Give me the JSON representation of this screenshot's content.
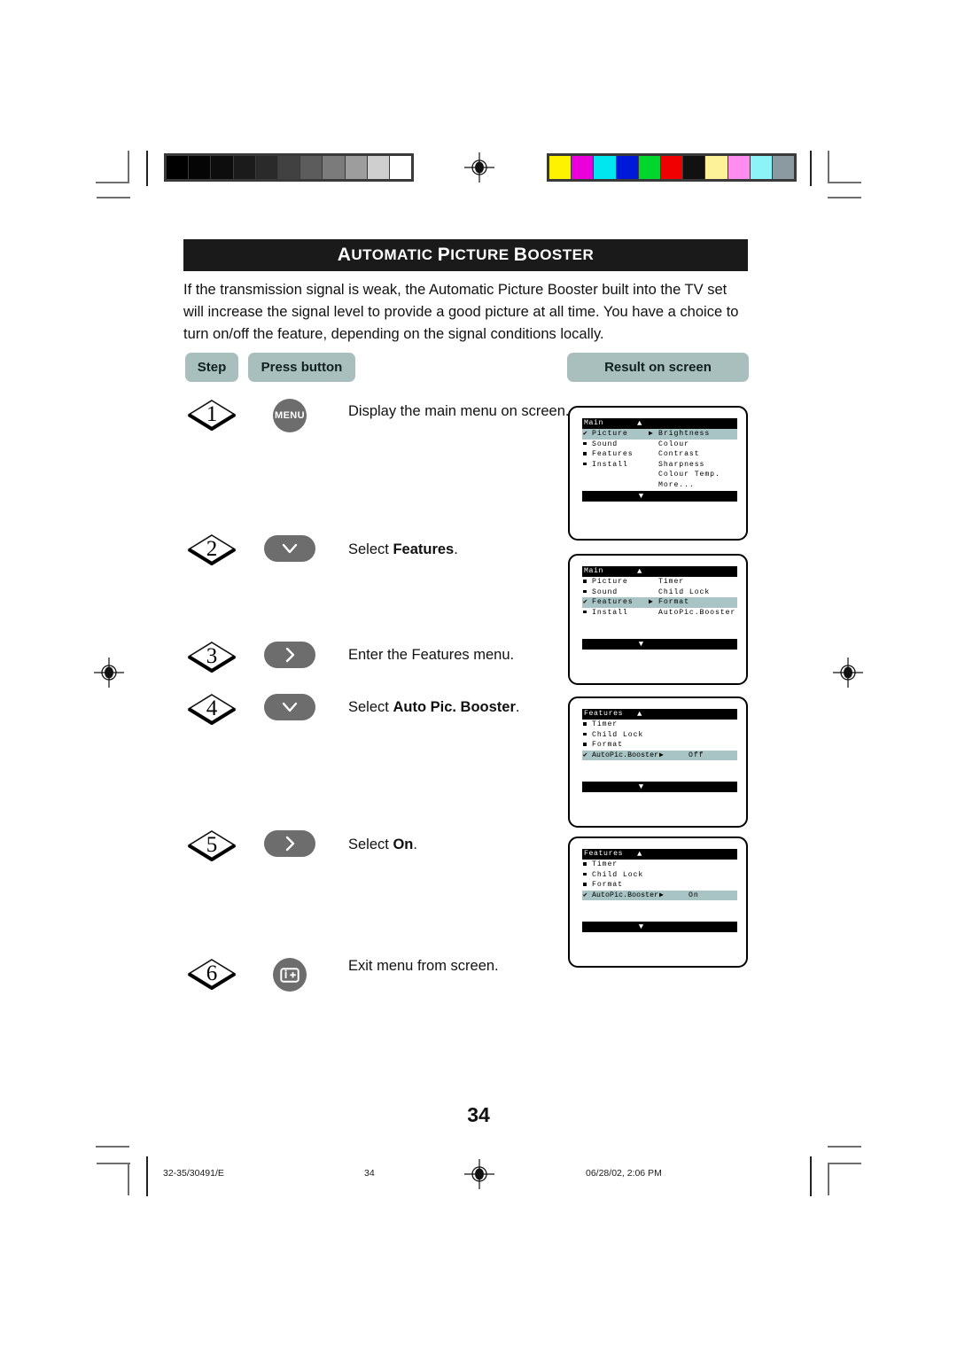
{
  "document": {
    "title_words": [
      "Automatic",
      "Picture",
      "Booster"
    ],
    "title_full": "AUTOMATIC PICTURE BOOSTER",
    "intro": "If the transmission signal is weak, the Automatic Picture Booster built into the TV set will increase the signal level to provide a good picture at all time. You have a choice to turn on/off the feature, depending on the signal conditions locally.",
    "page_number": "34"
  },
  "table_headers": {
    "step": "Step",
    "press_button": "Press button",
    "result": "Result on screen"
  },
  "steps": [
    {
      "number": "1",
      "button_kind": "round",
      "button_label": "MENU",
      "icon_name": "menu-button",
      "text_prefix": "Display the main menu on screen.",
      "text_bold": "",
      "text_suffix": ""
    },
    {
      "number": "2",
      "button_kind": "oval",
      "button_label": "",
      "icon_name": "chevron-down-icon",
      "text_prefix": "Select ",
      "text_bold": "Features",
      "text_suffix": "."
    },
    {
      "number": "3",
      "button_kind": "oval",
      "button_label": "",
      "icon_name": "chevron-right-icon",
      "text_prefix": "Enter the Features menu.",
      "text_bold": "",
      "text_suffix": ""
    },
    {
      "number": "4",
      "button_kind": "oval",
      "button_label": "",
      "icon_name": "chevron-down-icon",
      "text_prefix": "Select ",
      "text_bold": "Auto Pic. Booster",
      "text_suffix": "."
    },
    {
      "number": "5",
      "button_kind": "oval",
      "button_label": "",
      "icon_name": "chevron-right-icon",
      "text_prefix": "Select ",
      "text_bold": "On",
      "text_suffix": "."
    },
    {
      "number": "6",
      "button_kind": "round",
      "button_label": "",
      "icon_name": "exit-info-button",
      "text_prefix": "Exit menu from screen.",
      "text_bold": "",
      "text_suffix": ""
    }
  ],
  "osd_screens": [
    {
      "name": "main-picture",
      "title": "Main",
      "rows": [
        {
          "mark": "check",
          "left": "Picture",
          "arrow": true,
          "right": "Brightness",
          "highlight": true
        },
        {
          "mark": "square",
          "left": "Sound",
          "arrow": false,
          "right": "Colour",
          "highlight": false
        },
        {
          "mark": "square",
          "left": "Features",
          "arrow": false,
          "right": "Contrast",
          "highlight": false
        },
        {
          "mark": "square",
          "left": "Install",
          "arrow": false,
          "right": "Sharpness",
          "highlight": false
        },
        {
          "mark": "none",
          "left": "",
          "arrow": false,
          "right": "Colour Temp.",
          "highlight": false
        },
        {
          "mark": "none",
          "left": "",
          "arrow": false,
          "right": "More...",
          "highlight": false
        }
      ],
      "blank_rows": 0
    },
    {
      "name": "main-features",
      "title": "Main",
      "rows": [
        {
          "mark": "square",
          "left": "Picture",
          "arrow": false,
          "right": "Timer",
          "highlight": false
        },
        {
          "mark": "square",
          "left": "Sound",
          "arrow": false,
          "right": "Child Lock",
          "highlight": false
        },
        {
          "mark": "check",
          "left": "Features",
          "arrow": true,
          "right": "Format",
          "highlight": true
        },
        {
          "mark": "square",
          "left": "Install",
          "arrow": false,
          "right": "AutoPic.Booster",
          "highlight": false
        }
      ],
      "blank_rows": 2
    },
    {
      "name": "features-autopic-off",
      "title": "Features",
      "rows": [
        {
          "mark": "square",
          "left": "Timer",
          "arrow": false,
          "right": "",
          "highlight": false
        },
        {
          "mark": "square",
          "left": "Child Lock",
          "arrow": false,
          "right": "",
          "highlight": false
        },
        {
          "mark": "square",
          "left": "Format",
          "arrow": false,
          "right": "",
          "highlight": false
        },
        {
          "mark": "check",
          "left": "AutoPic.Booster",
          "arrow": true,
          "right": "Off",
          "highlight": true
        }
      ],
      "blank_rows": 2
    },
    {
      "name": "features-autopic-on",
      "title": "Features",
      "rows": [
        {
          "mark": "square",
          "left": "Timer",
          "arrow": false,
          "right": "",
          "highlight": false
        },
        {
          "mark": "square",
          "left": "Child Lock",
          "arrow": false,
          "right": "",
          "highlight": false
        },
        {
          "mark": "square",
          "left": "Format",
          "arrow": false,
          "right": "",
          "highlight": false
        },
        {
          "mark": "check",
          "left": "AutoPic.Booster",
          "arrow": true,
          "right": "On",
          "highlight": true
        }
      ],
      "blank_rows": 2
    }
  ],
  "footer": {
    "left": "32-35/30491/E",
    "center": "34",
    "right": "06/28/02, 2:06 PM"
  },
  "colors": {
    "pill_bg": "#a8bfbd",
    "osd_highlight": "#a8c4c4",
    "title_bg": "#1a1a1a",
    "button_bg": "#6d6d6d"
  },
  "print_bars": {
    "grayscale": [
      "#000000",
      "#050505",
      "#0d0d0d",
      "#1b1b1b",
      "#2a2a2a",
      "#414141",
      "#5c5c5c",
      "#7b7b7b",
      "#9d9d9d",
      "#cfcfcf",
      "#ffffff"
    ],
    "colour": [
      "#fff200",
      "#ec00d9",
      "#00e7f0",
      "#0018d8",
      "#00d62b",
      "#f00000",
      "#111111",
      "#fdf29a",
      "#ff8df0",
      "#8cf4f9",
      "#8a9aa0"
    ]
  }
}
